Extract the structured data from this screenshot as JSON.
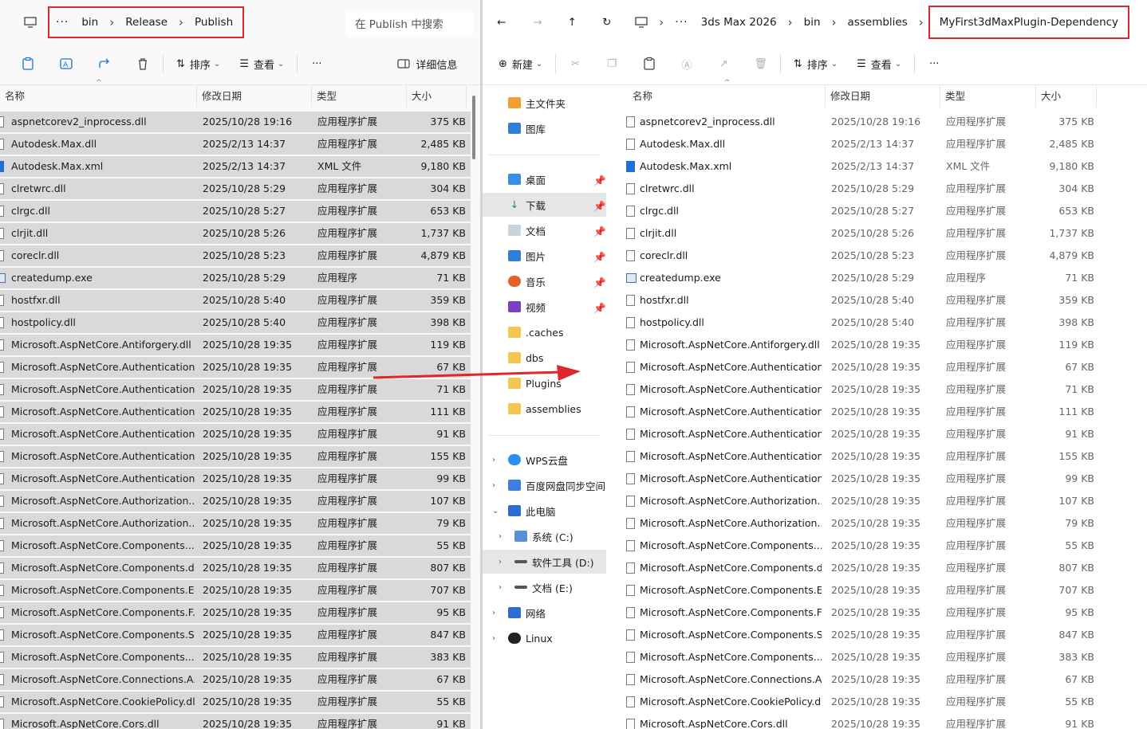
{
  "left": {
    "breadcrumb": [
      "bin",
      "Release",
      "Publish"
    ],
    "search_placeholder": "在 Publish 中搜索",
    "toolbar": {
      "sort": "排序",
      "view": "查看",
      "details": "详细信息"
    },
    "columns": [
      "名称",
      "修改日期",
      "类型",
      "大小"
    ]
  },
  "right": {
    "breadcrumb": [
      "3ds Max 2026",
      "bin",
      "assemblies",
      "MyFirst3dMaxPlugin-Dependency"
    ],
    "toolbar": {
      "new": "新建",
      "sort": "排序",
      "view": "查看"
    },
    "columns": [
      "名称",
      "修改日期",
      "类型",
      "大小"
    ],
    "nav": {
      "home": "主文件夹",
      "gallery": "图库",
      "quick": [
        "桌面",
        "下载",
        "文档",
        "图片",
        "音乐",
        "视频"
      ],
      "folders": [
        ".caches",
        "dbs",
        "Plugins",
        "assemblies"
      ],
      "cloud": [
        "WPS云盘",
        "百度网盘同步空间"
      ],
      "this_pc": "此电脑",
      "drives": [
        "系统 (C:)",
        "软件工具 (D:)",
        "文档 (E:)"
      ],
      "network": "网络",
      "linux": "Linux"
    }
  },
  "files": [
    {
      "name": "aspnetcorev2_inprocess.dll",
      "date": "2025/10/28 19:16",
      "type": "应用程序扩展",
      "size": "375 KB",
      "icon": "dll"
    },
    {
      "name": "Autodesk.Max.dll",
      "date": "2025/2/13 14:37",
      "type": "应用程序扩展",
      "size": "2,485 KB",
      "icon": "dll"
    },
    {
      "name": "Autodesk.Max.xml",
      "date": "2025/2/13 14:37",
      "type": "XML 文件",
      "size": "9,180 KB",
      "icon": "xml"
    },
    {
      "name": "clretwrc.dll",
      "date": "2025/10/28 5:29",
      "type": "应用程序扩展",
      "size": "304 KB",
      "icon": "dll"
    },
    {
      "name": "clrgc.dll",
      "date": "2025/10/28 5:27",
      "type": "应用程序扩展",
      "size": "653 KB",
      "icon": "dll"
    },
    {
      "name": "clrjit.dll",
      "date": "2025/10/28 5:26",
      "type": "应用程序扩展",
      "size": "1,737 KB",
      "icon": "dll"
    },
    {
      "name": "coreclr.dll",
      "date": "2025/10/28 5:23",
      "type": "应用程序扩展",
      "size": "4,879 KB",
      "icon": "dll"
    },
    {
      "name": "createdump.exe",
      "date": "2025/10/28 5:29",
      "type": "应用程序",
      "size": "71 KB",
      "icon": "exe"
    },
    {
      "name": "hostfxr.dll",
      "date": "2025/10/28 5:40",
      "type": "应用程序扩展",
      "size": "359 KB",
      "icon": "dll"
    },
    {
      "name": "hostpolicy.dll",
      "date": "2025/10/28 5:40",
      "type": "应用程序扩展",
      "size": "398 KB",
      "icon": "dll"
    },
    {
      "name": "Microsoft.AspNetCore.Antiforgery.dll",
      "date": "2025/10/28 19:35",
      "type": "应用程序扩展",
      "size": "119 KB",
      "icon": "dll"
    },
    {
      "name": "Microsoft.AspNetCore.Authentication...",
      "date": "2025/10/28 19:35",
      "type": "应用程序扩展",
      "size": "67 KB",
      "icon": "dll"
    },
    {
      "name": "Microsoft.AspNetCore.Authentication...",
      "date": "2025/10/28 19:35",
      "type": "应用程序扩展",
      "size": "71 KB",
      "icon": "dll"
    },
    {
      "name": "Microsoft.AspNetCore.Authentication...",
      "date": "2025/10/28 19:35",
      "type": "应用程序扩展",
      "size": "111 KB",
      "icon": "dll"
    },
    {
      "name": "Microsoft.AspNetCore.Authentication...",
      "date": "2025/10/28 19:35",
      "type": "应用程序扩展",
      "size": "91 KB",
      "icon": "dll"
    },
    {
      "name": "Microsoft.AspNetCore.Authentication...",
      "date": "2025/10/28 19:35",
      "type": "应用程序扩展",
      "size": "155 KB",
      "icon": "dll"
    },
    {
      "name": "Microsoft.AspNetCore.Authentication...",
      "date": "2025/10/28 19:35",
      "type": "应用程序扩展",
      "size": "99 KB",
      "icon": "dll"
    },
    {
      "name": "Microsoft.AspNetCore.Authorization....",
      "date": "2025/10/28 19:35",
      "type": "应用程序扩展",
      "size": "107 KB",
      "icon": "dll"
    },
    {
      "name": "Microsoft.AspNetCore.Authorization....",
      "date": "2025/10/28 19:35",
      "type": "应用程序扩展",
      "size": "79 KB",
      "icon": "dll"
    },
    {
      "name": "Microsoft.AspNetCore.Components....",
      "date": "2025/10/28 19:35",
      "type": "应用程序扩展",
      "size": "55 KB",
      "icon": "dll"
    },
    {
      "name": "Microsoft.AspNetCore.Components.dll",
      "date": "2025/10/28 19:35",
      "type": "应用程序扩展",
      "size": "807 KB",
      "icon": "dll"
    },
    {
      "name": "Microsoft.AspNetCore.Components.E...",
      "date": "2025/10/28 19:35",
      "type": "应用程序扩展",
      "size": "707 KB",
      "icon": "dll"
    },
    {
      "name": "Microsoft.AspNetCore.Components.F...",
      "date": "2025/10/28 19:35",
      "type": "应用程序扩展",
      "size": "95 KB",
      "icon": "dll"
    },
    {
      "name": "Microsoft.AspNetCore.Components.S...",
      "date": "2025/10/28 19:35",
      "type": "应用程序扩展",
      "size": "847 KB",
      "icon": "dll"
    },
    {
      "name": "Microsoft.AspNetCore.Components....",
      "date": "2025/10/28 19:35",
      "type": "应用程序扩展",
      "size": "383 KB",
      "icon": "dll"
    },
    {
      "name": "Microsoft.AspNetCore.Connections.A...",
      "date": "2025/10/28 19:35",
      "type": "应用程序扩展",
      "size": "67 KB",
      "icon": "dll"
    },
    {
      "name": "Microsoft.AspNetCore.CookiePolicy.dll",
      "date": "2025/10/28 19:35",
      "type": "应用程序扩展",
      "size": "55 KB",
      "icon": "dll"
    },
    {
      "name": "Microsoft.AspNetCore.Cors.dll",
      "date": "2025/10/28 19:35",
      "type": "应用程序扩展",
      "size": "91 KB",
      "icon": "dll"
    }
  ],
  "colors": {
    "highlight_box": "#e0262d",
    "selection_row": "#d9d9d9",
    "arrow": "#e0262d"
  }
}
